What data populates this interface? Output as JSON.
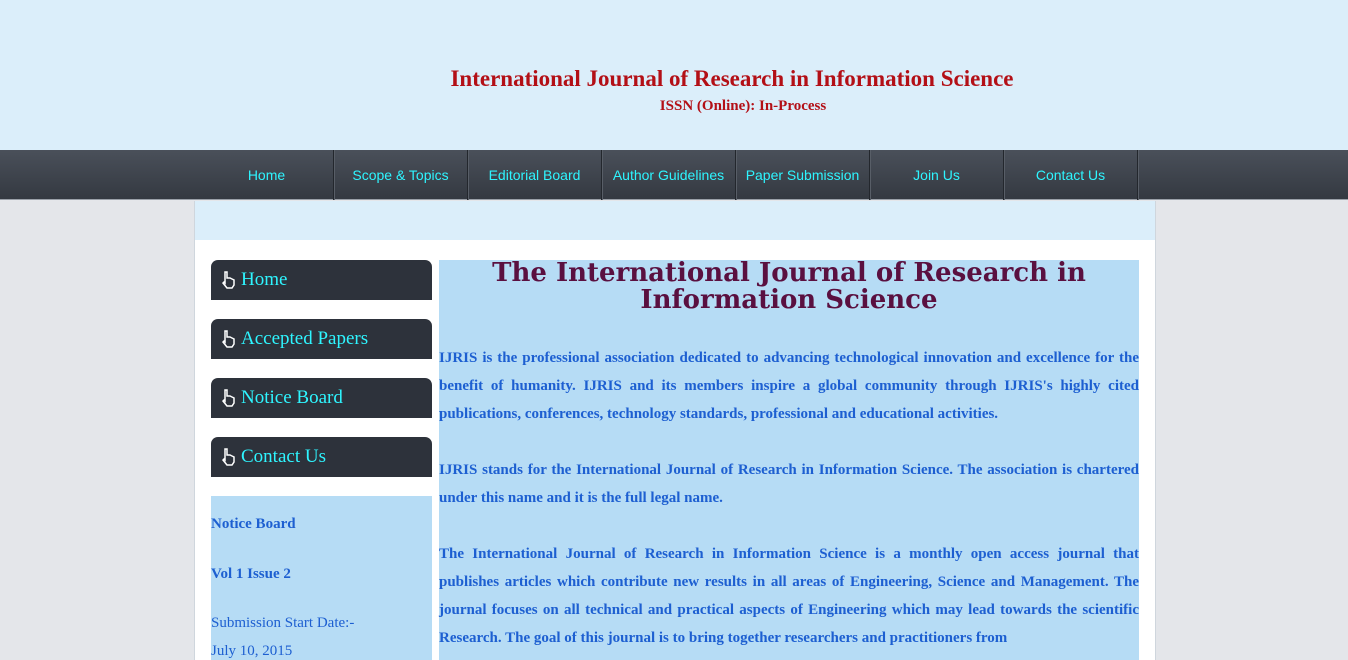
{
  "header": {
    "title": "International Journal of Research in Information Science",
    "issn": "ISSN (Online): In-Process"
  },
  "nav": {
    "items": [
      "Home",
      "Scope & Topics",
      "Editorial Board",
      "Author Guidelines",
      "Paper Submission",
      "Join Us",
      "Contact Us"
    ]
  },
  "sidebar": {
    "items": [
      {
        "label": "Home",
        "icon": "pointer-hand-icon"
      },
      {
        "label": "Accepted Papers",
        "icon": "pointer-hand-icon"
      },
      {
        "label": "Notice Board",
        "icon": "pointer-hand-icon"
      },
      {
        "label": "Contact Us",
        "icon": "pointer-hand-icon"
      }
    ],
    "notice": {
      "heading": "Notice Board",
      "volume": "Vol 1 Issue 2",
      "start_label": "Submission Start Date:-",
      "start_date": "July 10, 2015"
    }
  },
  "main": {
    "title": "The International Journal of Research in Information Science",
    "paragraphs": [
      " IJRIS is the professional association dedicated to advancing technological innovation and excellence for the benefit of humanity. IJRIS and its members inspire a global community through IJRIS's highly cited publications, conferences, technology standards, professional and educational activities.",
      "IJRIS stands for the International Journal of Research in Information Science. The association is chartered under this name and it is the full legal name.",
      "The International Journal of Research in Information Science is a monthly open access journal that publishes articles which contribute new results in all areas of Engineering, Science and Management. The journal focuses on all technical and practical aspects of Engineering which may lead towards the scientific Research. The goal of this journal is to bring together researchers and practitioners from"
    ]
  },
  "colors": {
    "header_bg": "#dbeefa",
    "title_red": "#b30f16",
    "nav_text": "#2ef5ff",
    "content_blue": "#1d5fd1",
    "main_title": "#5a1040",
    "panel_bg": "#b6dcf5"
  }
}
